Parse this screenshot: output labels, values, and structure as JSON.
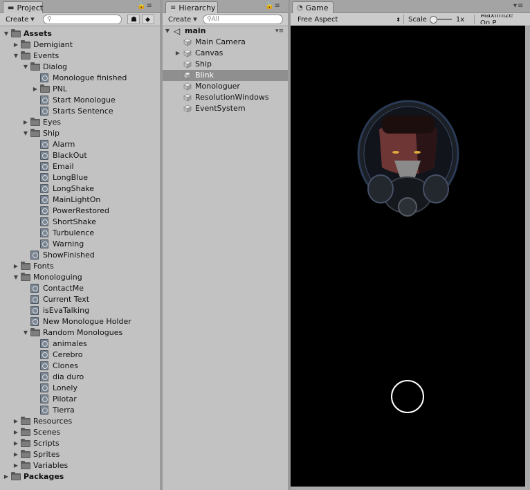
{
  "project": {
    "tab_label": "Project",
    "create_label": "Create",
    "search_placeholder": "",
    "tree": [
      {
        "label": "Assets",
        "depth": 0,
        "arrow": "down",
        "type": "folder",
        "bold": true
      },
      {
        "label": "Demigiant",
        "depth": 1,
        "arrow": "right",
        "type": "folder"
      },
      {
        "label": "Events",
        "depth": 1,
        "arrow": "down",
        "type": "folder"
      },
      {
        "label": "Dialog",
        "depth": 2,
        "arrow": "down",
        "type": "folder"
      },
      {
        "label": "Monologue finished",
        "depth": 3,
        "arrow": "",
        "type": "asset"
      },
      {
        "label": "PNL",
        "depth": 3,
        "arrow": "right",
        "type": "folder"
      },
      {
        "label": "Start Monologue",
        "depth": 3,
        "arrow": "",
        "type": "asset"
      },
      {
        "label": "Starts Sentence",
        "depth": 3,
        "arrow": "",
        "type": "asset"
      },
      {
        "label": "Eyes",
        "depth": 2,
        "arrow": "right",
        "type": "folder"
      },
      {
        "label": "Ship",
        "depth": 2,
        "arrow": "down",
        "type": "folder"
      },
      {
        "label": "Alarm",
        "depth": 3,
        "arrow": "",
        "type": "asset"
      },
      {
        "label": "BlackOut",
        "depth": 3,
        "arrow": "",
        "type": "asset"
      },
      {
        "label": "Email",
        "depth": 3,
        "arrow": "",
        "type": "asset"
      },
      {
        "label": "LongBlue",
        "depth": 3,
        "arrow": "",
        "type": "asset"
      },
      {
        "label": "LongShake",
        "depth": 3,
        "arrow": "",
        "type": "asset"
      },
      {
        "label": "MainLightOn",
        "depth": 3,
        "arrow": "",
        "type": "asset"
      },
      {
        "label": "PowerRestored",
        "depth": 3,
        "arrow": "",
        "type": "asset"
      },
      {
        "label": "ShortShake",
        "depth": 3,
        "arrow": "",
        "type": "asset"
      },
      {
        "label": "Turbulence",
        "depth": 3,
        "arrow": "",
        "type": "asset"
      },
      {
        "label": "Warning",
        "depth": 3,
        "arrow": "",
        "type": "asset"
      },
      {
        "label": "ShowFinished",
        "depth": 2,
        "arrow": "",
        "type": "asset"
      },
      {
        "label": "Fonts",
        "depth": 1,
        "arrow": "right",
        "type": "folder"
      },
      {
        "label": "Monologuing",
        "depth": 1,
        "arrow": "down",
        "type": "folder"
      },
      {
        "label": "ContactMe",
        "depth": 2,
        "arrow": "",
        "type": "asset"
      },
      {
        "label": "Current Text",
        "depth": 2,
        "arrow": "",
        "type": "asset"
      },
      {
        "label": "isEvaTalking",
        "depth": 2,
        "arrow": "",
        "type": "asset"
      },
      {
        "label": "New Monologue Holder",
        "depth": 2,
        "arrow": "",
        "type": "asset"
      },
      {
        "label": "Random Monologues",
        "depth": 2,
        "arrow": "down",
        "type": "folder"
      },
      {
        "label": "animales",
        "depth": 3,
        "arrow": "",
        "type": "asset"
      },
      {
        "label": "Cerebro",
        "depth": 3,
        "arrow": "",
        "type": "asset"
      },
      {
        "label": "Clones",
        "depth": 3,
        "arrow": "",
        "type": "asset"
      },
      {
        "label": "dia duro",
        "depth": 3,
        "arrow": "",
        "type": "asset"
      },
      {
        "label": "Lonely",
        "depth": 3,
        "arrow": "",
        "type": "asset"
      },
      {
        "label": "Pilotar",
        "depth": 3,
        "arrow": "",
        "type": "asset"
      },
      {
        "label": "Tierra",
        "depth": 3,
        "arrow": "",
        "type": "asset"
      },
      {
        "label": "Resources",
        "depth": 1,
        "arrow": "right",
        "type": "folder"
      },
      {
        "label": "Scenes",
        "depth": 1,
        "arrow": "right",
        "type": "folder"
      },
      {
        "label": "Scripts",
        "depth": 1,
        "arrow": "right",
        "type": "folder"
      },
      {
        "label": "Sprites",
        "depth": 1,
        "arrow": "right",
        "type": "folder"
      },
      {
        "label": "Variables",
        "depth": 1,
        "arrow": "right",
        "type": "folder"
      },
      {
        "label": "Packages",
        "depth": 0,
        "arrow": "right",
        "type": "folder",
        "bold": true
      }
    ]
  },
  "hierarchy": {
    "tab_label": "Hierarchy",
    "create_label": "Create",
    "search_placeholder": "All",
    "scene_name": "main",
    "items": [
      {
        "label": "Main Camera",
        "arrow": "",
        "selected": false
      },
      {
        "label": "Canvas",
        "arrow": "right",
        "selected": false
      },
      {
        "label": "Ship",
        "arrow": "",
        "selected": false
      },
      {
        "label": "Blink",
        "arrow": "",
        "selected": true
      },
      {
        "label": "Monologuer",
        "arrow": "",
        "selected": false
      },
      {
        "label": "ResolutionWindows",
        "arrow": "",
        "selected": false
      },
      {
        "label": "EventSystem",
        "arrow": "",
        "selected": false
      }
    ]
  },
  "game": {
    "tab_label": "Game",
    "aspect_label": "Free Aspect",
    "scale_label": "Scale",
    "scale_value": "1x",
    "maximize_label": "Maximize On P",
    "accent_selection": "#8f8f8f"
  }
}
